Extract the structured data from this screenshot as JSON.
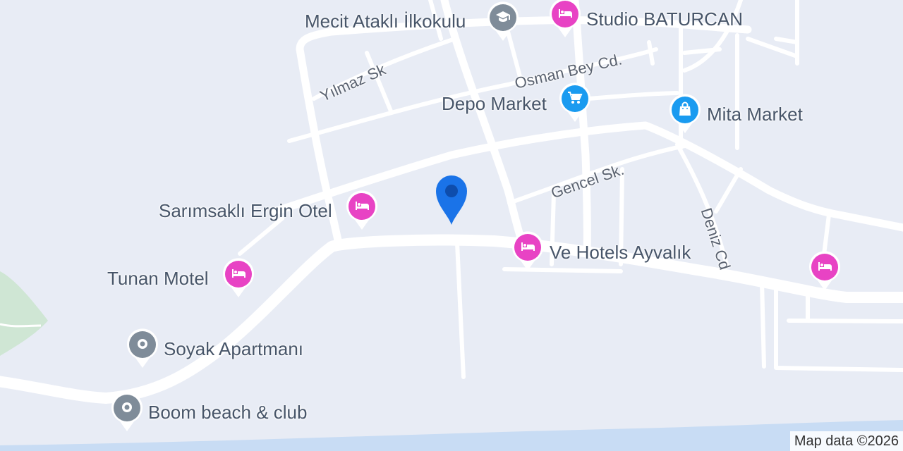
{
  "map": {
    "attribution": "Map data ©2026",
    "colors": {
      "background": "#e8ecf5",
      "road": "#ffffff",
      "water": "#c8dcf4",
      "park": "#cfe6d4",
      "lodging_pin": "#e843c4",
      "shopping_pin": "#1a9bf0",
      "generic_pin": "#7f8c99",
      "school_pin": "#7f8c99",
      "location_marker": "#1a73e8"
    },
    "streets": [
      {
        "label": "Yılmaz Sk"
      },
      {
        "label": "Osman Bey Cd."
      },
      {
        "label": "Gencel Sk."
      },
      {
        "label": "Deniz Cd"
      }
    ],
    "places": [
      {
        "label": "Mecit Ataklı İlkokulu",
        "icon": "school-icon",
        "category": "school"
      },
      {
        "label": "Studio BATURCAN",
        "icon": "bed-icon",
        "category": "lodging"
      },
      {
        "label": "Depo Market",
        "icon": "cart-icon",
        "category": "shopping"
      },
      {
        "label": "Mita Market",
        "icon": "shopping-bag-icon",
        "category": "shopping"
      },
      {
        "label": "Sarımsaklı Ergin Otel",
        "icon": "bed-icon",
        "category": "lodging"
      },
      {
        "label": "Ve Hotels Ayvalık",
        "icon": "bed-icon",
        "category": "lodging"
      },
      {
        "label": "Tunan Motel",
        "icon": "bed-icon",
        "category": "lodging"
      },
      {
        "label": "Soyak Apartmanı",
        "icon": "circle-icon",
        "category": "generic"
      },
      {
        "label": "Boom beach & club",
        "icon": "circle-icon",
        "category": "generic"
      },
      {
        "label": "",
        "icon": "bed-icon",
        "category": "lodging"
      }
    ],
    "marker": {
      "icon": "location-pin-icon"
    }
  }
}
